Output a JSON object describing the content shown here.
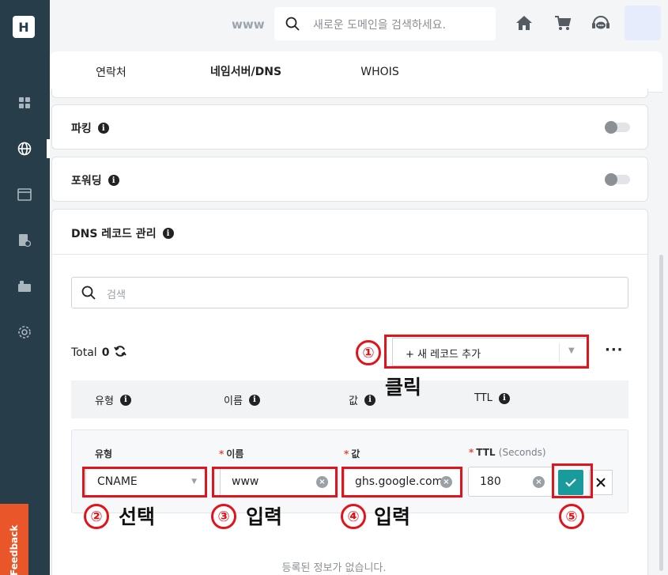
{
  "sidebar": {
    "logo": "H",
    "items": [
      {
        "icon": "dashboard-icon"
      },
      {
        "icon": "globe-icon"
      },
      {
        "icon": "window-icon"
      },
      {
        "icon": "document-check-icon"
      },
      {
        "icon": "id-card-icon"
      },
      {
        "icon": "gear-icon"
      }
    ],
    "feedback_label": "Feedback"
  },
  "topbar": {
    "domain_prefix": "www",
    "search_placeholder": "새로운 도메인을 검색하세요.",
    "icons": [
      "home-icon",
      "cart-icon",
      "support-chat-icon"
    ]
  },
  "tabs": [
    {
      "label": "연락처",
      "active": false
    },
    {
      "label": "네임서버/DNS",
      "active": true
    },
    {
      "label": "WHOIS",
      "active": false
    }
  ],
  "parking": {
    "title": "파킹",
    "enabled": false
  },
  "forwarding": {
    "title": "포워딩",
    "enabled": false
  },
  "dns": {
    "title": "DNS 레코드 관리",
    "search_placeholder": "검색",
    "total_label": "Total",
    "total_count": "0",
    "add_button": "+ 새 레코드 추가",
    "more": "···",
    "columns": [
      "유형",
      "이름",
      "값",
      "TTL"
    ],
    "form": {
      "type_label": "유형",
      "name_label": "이름",
      "value_label": "값",
      "ttl_label": "TTL",
      "ttl_unit": "(Seconds)",
      "required_mark": "*",
      "type_value": "CNAME",
      "name_value": "www",
      "value_value": "ghs.google.com",
      "ttl_value": "180"
    },
    "empty_message": "등록된 정보가 없습니다."
  },
  "annotations": {
    "n1": "①",
    "n1_text": "클릭",
    "n2": "②",
    "n2_text": "선택",
    "n3": "③",
    "n3_text": "입력",
    "n4": "④",
    "n4_text": "입력",
    "n5": "⑤",
    "color": "#e3131b"
  },
  "colors": {
    "sidebar": "#283d4a",
    "accent": "#1a9b9b",
    "feedback": "#e8562a"
  }
}
